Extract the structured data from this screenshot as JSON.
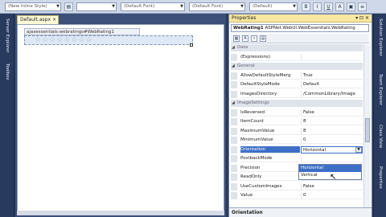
{
  "toolbar": {
    "style_combo": "(New Inline Style)",
    "combo2": "(Default Font)",
    "combo3": "(Default Font)",
    "combo4": "(Default)"
  },
  "left_strip": {
    "items": [
      "Server Explorer",
      "Toolbox"
    ]
  },
  "editor": {
    "tab_title": "Default.aspx",
    "tab_close": "×",
    "control_tag": "ajaxessentials:webratings#WebRating1",
    "stars": "☆☆☆☆☆☆☆☆"
  },
  "properties": {
    "title": "Properties",
    "title_controls": "▾ ⊡ ✕",
    "selector_name": "WebRating1",
    "selector_type": "ASPNet.WebUI.WebEssentials.WebRating",
    "toolbar_buttons": [
      "▦",
      "A",
      "⚡",
      "▤"
    ],
    "rows": [
      {
        "type": "cat",
        "name": "Data"
      },
      {
        "type": "prop",
        "name": "(Expressions)",
        "value": ""
      },
      {
        "type": "cat",
        "name": "General"
      },
      {
        "type": "prop",
        "name": "AllowDefaultStyleMerg",
        "value": "True"
      },
      {
        "type": "prop",
        "name": "DefaultStyleMode",
        "value": "Default"
      },
      {
        "type": "prop",
        "name": "ImagesDirectory",
        "value": "/CommonLibrary/Image"
      },
      {
        "type": "cat",
        "name": "ImageSettings"
      },
      {
        "type": "prop",
        "name": "IsReversed",
        "value": "False"
      },
      {
        "type": "prop",
        "name": "ItemCount",
        "value": "8"
      },
      {
        "type": "prop",
        "name": "MaximumValue",
        "value": "8"
      },
      {
        "type": "prop",
        "name": "MinimumValue",
        "value": "0"
      },
      {
        "type": "sel",
        "name": "Orientation",
        "value": "Horizontal"
      },
      {
        "type": "prop",
        "name": "PostbackMode",
        "value": ""
      },
      {
        "type": "prop",
        "name": "Precision",
        "value": ""
      },
      {
        "type": "prop",
        "name": "ReadOnly",
        "value": "False"
      },
      {
        "type": "prop",
        "name": "UseCustomImages",
        "value": "False"
      },
      {
        "type": "prop",
        "name": "Value",
        "value": "0"
      }
    ],
    "dropdown_options": [
      "Horizontal",
      "Vertical"
    ],
    "description": "Orientation"
  },
  "right_strip": {
    "items": [
      "Solution Explorer",
      "Team Explorer",
      "Class View",
      "Properties"
    ]
  },
  "colors": {
    "accent": "#3d6fc7",
    "title_bar": "#f8e7a0",
    "chrome": "#283a5e"
  }
}
